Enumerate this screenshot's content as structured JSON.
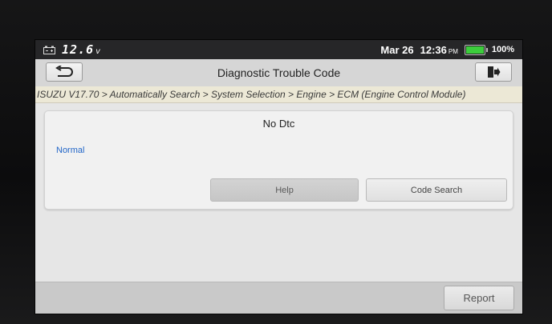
{
  "status_bar": {
    "voltage": "12.6",
    "voltage_unit": "v",
    "date": "Mar 26",
    "time": "12:36",
    "ampm": "PM",
    "battery_percent": "100%",
    "battery_level": 1.0,
    "battery_color": "#3ccd3c"
  },
  "title_bar": {
    "title": "Diagnostic Trouble Code",
    "back_icon": "back-arrow-icon",
    "exit_icon": "exit-door-icon"
  },
  "breadcrumb": "ISUZU V17.70 > Automatically Search > System Selection > Engine > ECM (Engine Control Module)",
  "dtc_panel": {
    "title": "No Dtc",
    "status": "Normal",
    "status_color": "#2266c8",
    "help_label": "Help",
    "code_search_label": "Code Search"
  },
  "bottom_bar": {
    "report_label": "Report"
  }
}
